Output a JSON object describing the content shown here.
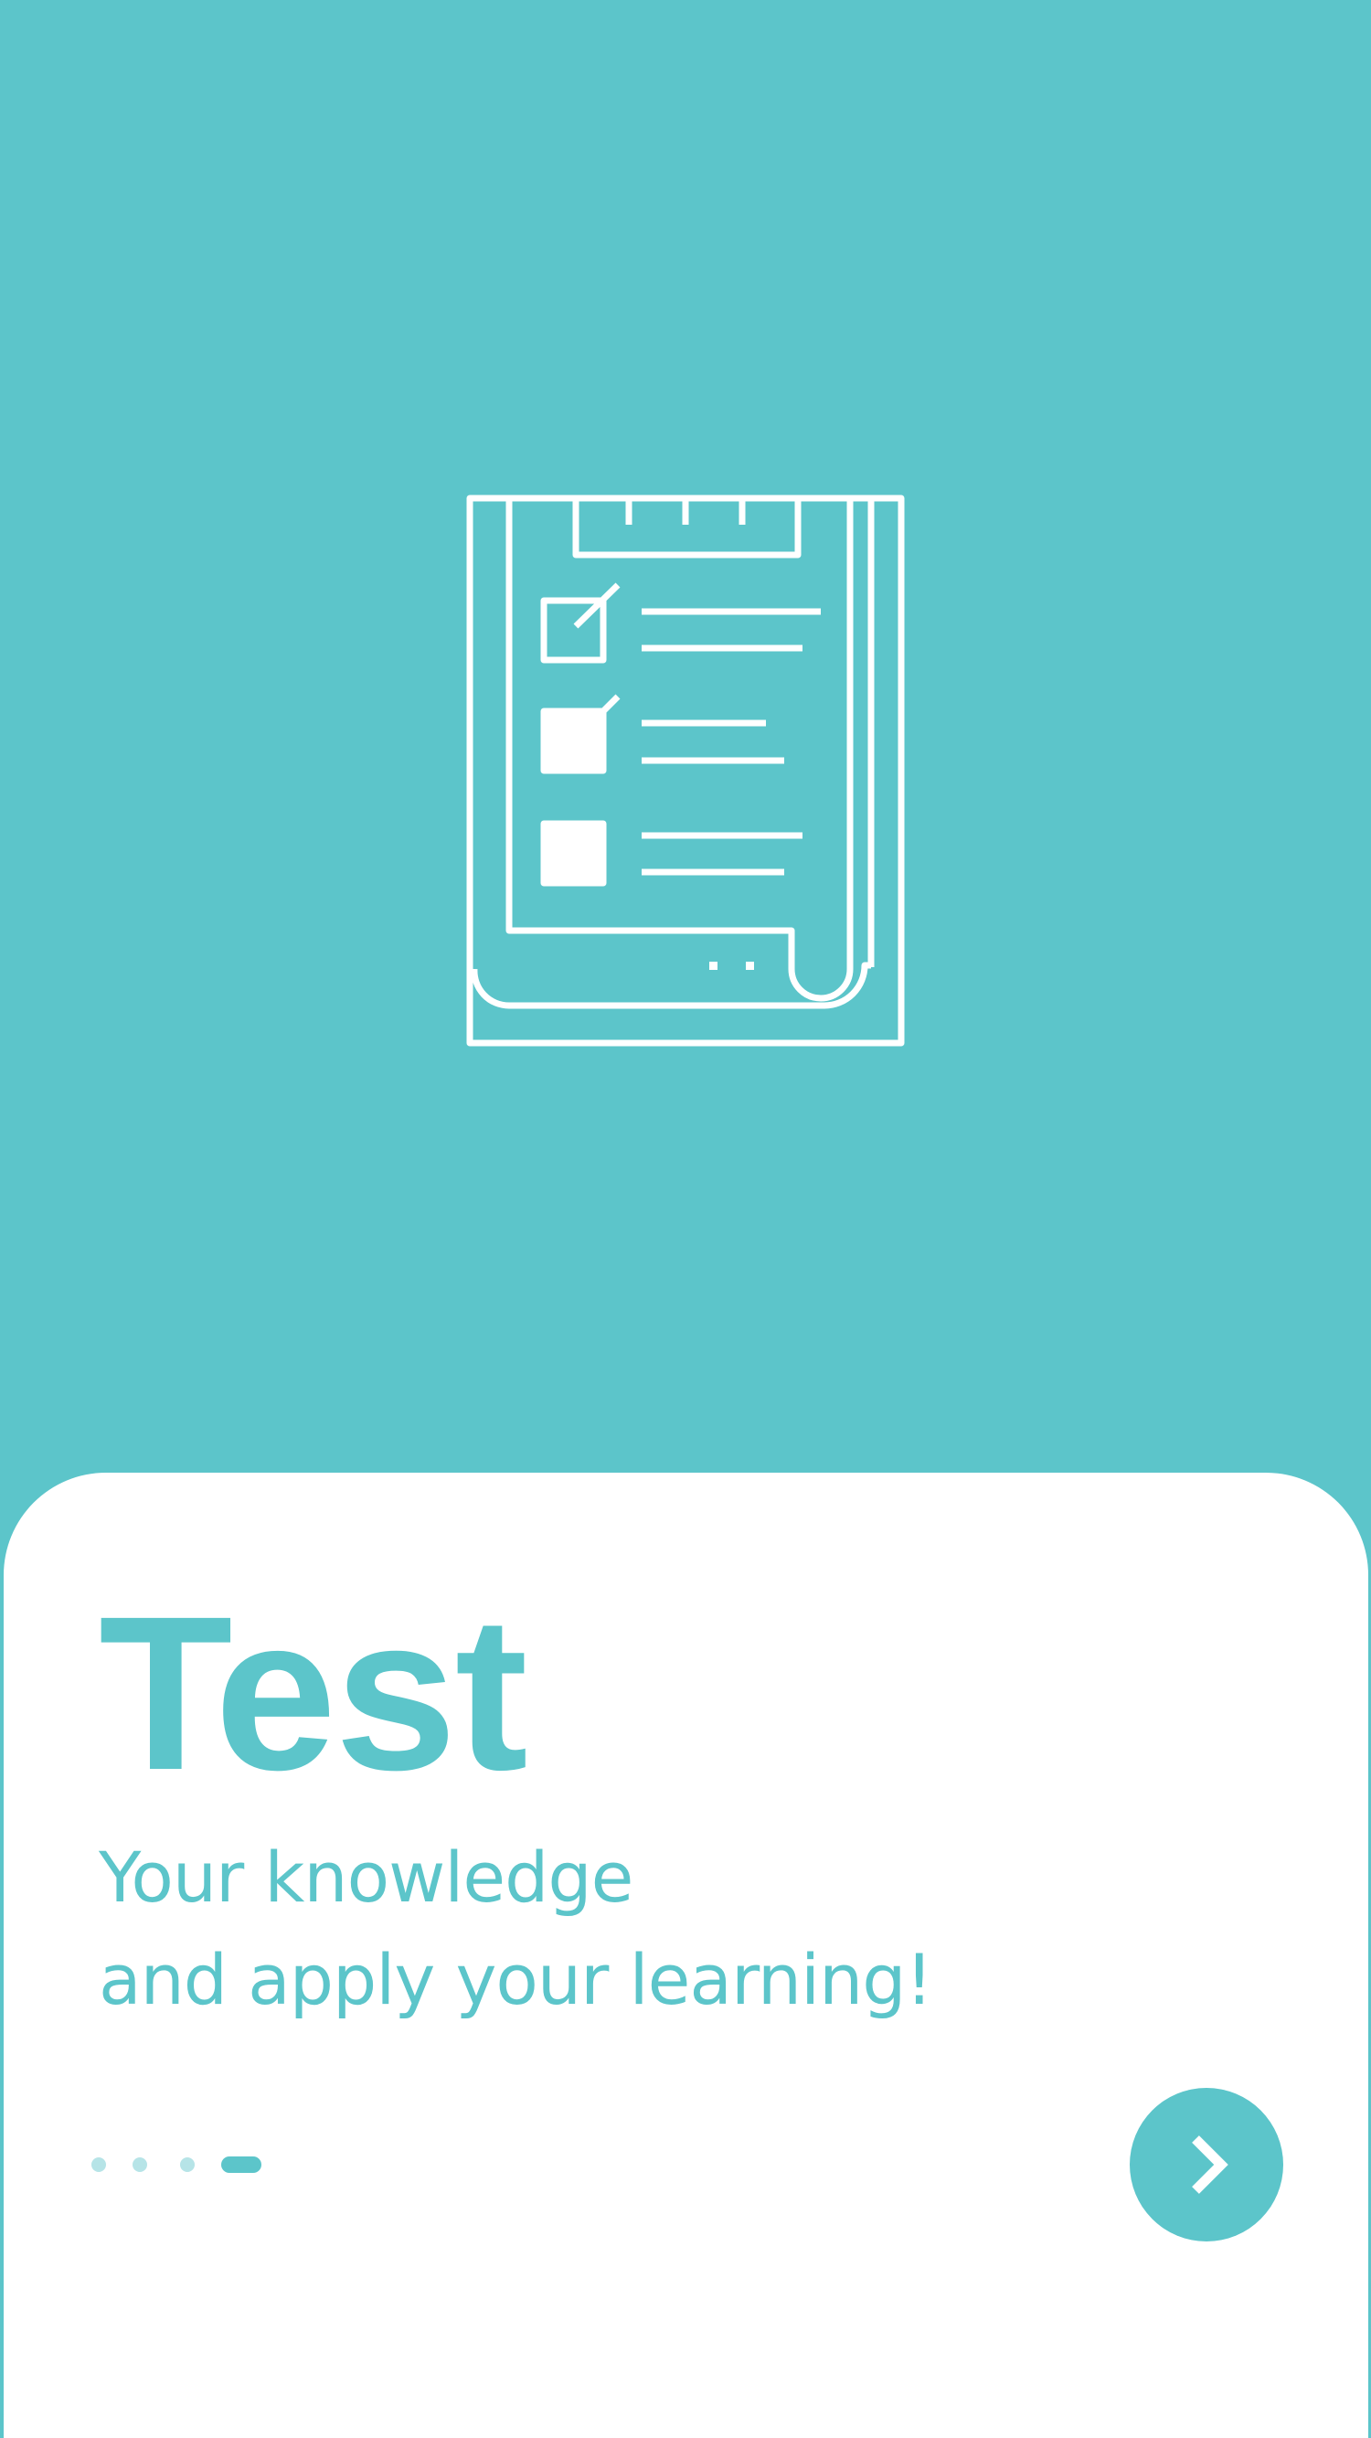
{
  "onboarding": {
    "title": "Test",
    "subtitle_lines": [
      "Your knowledge",
      "and apply your learning!"
    ],
    "pager": {
      "total": 4,
      "current": 4
    },
    "next_button_icon": "chevron-right-icon",
    "hero_icon": "clipboard-checklist-icon"
  },
  "colors": {
    "primary": "#5CC5CA",
    "card_background": "#FFFFFF",
    "inactive_dot": "#B6E4E7"
  }
}
